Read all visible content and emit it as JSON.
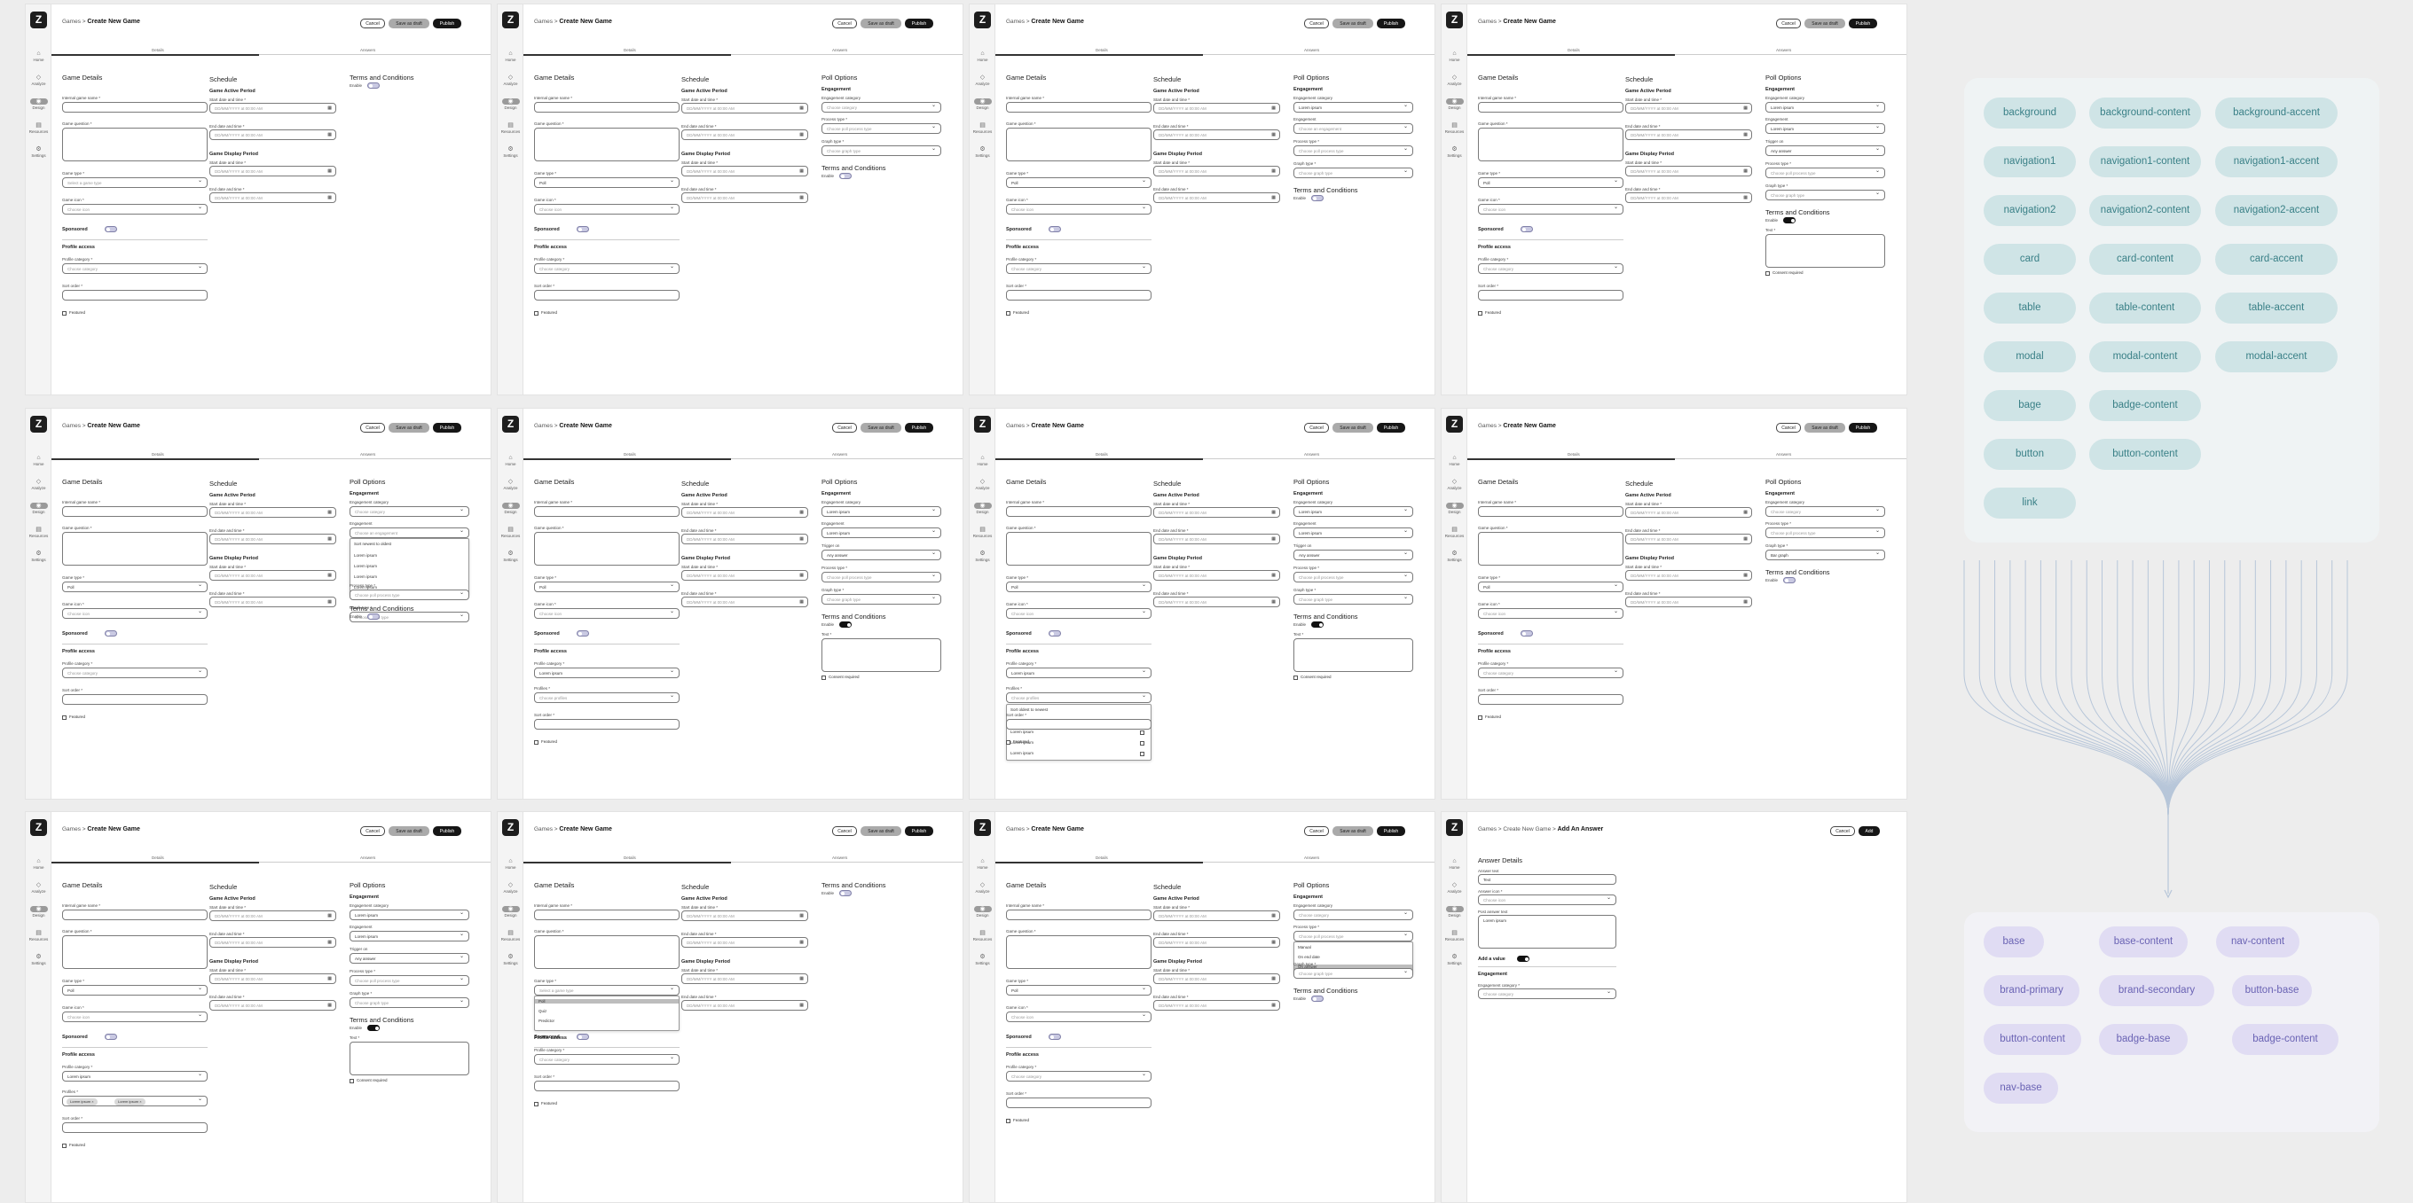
{
  "common": {
    "breadcrumb_root": "Games",
    "breadcrumb_sep": ">",
    "breadcrumb_page": "Create New Game",
    "cancel": "Cancel",
    "save_draft": "Save as draft",
    "publish": "Publish",
    "tab_details": "Details",
    "tab_answers": "Answers",
    "nav": [
      "Home",
      "Analyze",
      "Design",
      "Resources",
      "Settings"
    ],
    "game_details": "Game Details",
    "internal_name": "Internal game name *",
    "game_question": "Game question *",
    "game_type": "Game type *",
    "game_type_placeholder": "Select a game type",
    "game_type_value": "Poll",
    "game_icon": "Game icon *",
    "game_icon_placeholder": "Choose icon",
    "sponsored": "Sponsored",
    "profile_access": "Profile access",
    "profile_category": "Profile category *",
    "profile_category_placeholder": "Choose category",
    "profiles": "Profiles *",
    "profiles_placeholder": "Choose profiles",
    "sort_order": "Sort order *",
    "featured": "Featured",
    "schedule": "Schedule",
    "active_period": "Game Active Period",
    "display_period": "Game Display Period",
    "start": "Start date and time *",
    "end": "End date and time *",
    "date_placeholder": "DD/MM/YYYY at 00:00 AM",
    "terms": "Terms and Conditions",
    "enable": "Enable",
    "text": "Text *",
    "consent": "Consent required",
    "poll_options": "Poll Options",
    "engagement": "Engagement",
    "eng_category": "Engagement category",
    "eng_category_placeholder": "Choose category",
    "eng_field": "Engagement",
    "eng_placeholder": "Choose an engagement",
    "trigger_on": "Trigger on",
    "any_answer": "Any answer",
    "process_type": "Process type *",
    "process_placeholder": "Choose poll process type",
    "graph_type": "Graph type *",
    "graph_placeholder": "Choose graph type",
    "graph_value": "Bar graph",
    "lorem": "Lorem ipsum",
    "sort_newest": "Sort oldest to newest",
    "sort_newest_alt": "Sort newest to oldest",
    "game_types": [
      "Poll",
      "Quiz",
      "Predictor"
    ],
    "process_types": [
      "Manual",
      "On end date",
      "On answer"
    ]
  },
  "answer_frame": {
    "breadcrumb_mid": "Create New Game",
    "breadcrumb_page": "Add An Answer",
    "add": "Add",
    "answer_details": "Answer Details",
    "answer_text": "Answer text",
    "answer_text_value": "Text",
    "answer_icon": "Answer icon *",
    "answer_icon_placeholder": "Choose icon",
    "post_answer": "Post answer text",
    "post_answer_value": "Lorem ipsum",
    "add_value": "Add a value",
    "engagement": "Engagement",
    "eng_category": "Engagement category *",
    "eng_category_placeholder": "Choose category"
  },
  "tokens_teal": [
    "background",
    "background-content",
    "background-accent",
    "navigation1",
    "navigation1-content",
    "navigation1-accent",
    "navigation2",
    "navigation2-content",
    "navigation2-accent",
    "card",
    "card-content",
    "card-accent",
    "table",
    "table-content",
    "table-accent",
    "modal",
    "modal-content",
    "modal-accent",
    "bage",
    "badge-content",
    "button",
    "button-content",
    "link"
  ],
  "tokens_purple": [
    "base",
    "base-content",
    "nav-content",
    "brand-primary",
    "brand-secondary",
    "button-base",
    "button-content",
    "badge-base",
    "badge-content",
    "nav-base"
  ],
  "colors": {
    "teal_panel": "#eff3f4",
    "teal_chip": "#cfe4e6",
    "teal_text": "#3a8087",
    "purple_panel": "#f2f2f6",
    "purple_chip": "#e0dcf3",
    "purple_text": "#6a63b4",
    "fan_line": "#b7c6d9"
  }
}
